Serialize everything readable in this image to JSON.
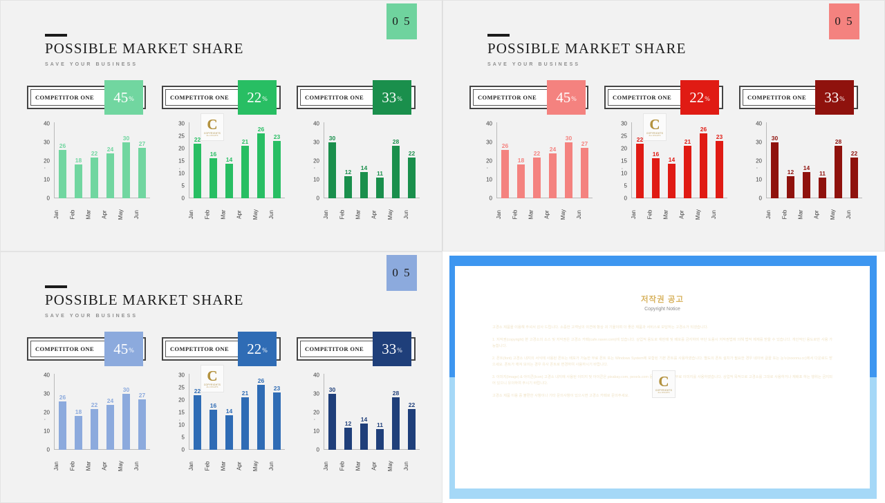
{
  "panels": [
    {
      "id": "green",
      "badge": "0 5",
      "badge_color": "#6fd39e",
      "title": "POSSIBLE MARKET SHARE",
      "subtitle": "SAVE YOUR BUSINESS",
      "accents": [
        "#71d6a0",
        "#28be63",
        "#1a8f4c"
      ]
    },
    {
      "id": "red",
      "badge": "0 5",
      "badge_color": "#f4827f",
      "title": "POSSIBLE MARKET SHARE",
      "subtitle": "SAVE YOUR BUSINESS",
      "accents": [
        "#f4827f",
        "#e01b14",
        "#8f120d"
      ]
    },
    {
      "id": "blue",
      "badge": "0 5",
      "badge_color": "#8caadd",
      "title": "POSSIBLE MARKET SHARE",
      "subtitle": "SAVE YOUR BUSINESS",
      "accents": [
        "#8caadd",
        "#2f6cb5",
        "#1f3f7a"
      ]
    }
  ],
  "meters": [
    {
      "label": "COMPETITOR ONE",
      "value": "45",
      "symbol": "%"
    },
    {
      "label": "COMPETITOR ONE",
      "value": "22",
      "symbol": "%"
    },
    {
      "label": "COMPETITOR ONE",
      "value": "33",
      "symbol": "%"
    }
  ],
  "watermark": {
    "letter": "C",
    "line1": "COPYRIGHTS",
    "line2": "ALL RIGHTS"
  },
  "copyright": {
    "title_kr": "저작권 공고",
    "title_en": "Copyright Notice",
    "paragraphs": [
      "고경소 제품을 이용해 주셔서 감사 드립니다. 소중한 고객님의 의견에 항상 귀 기울이며 더 좋은 제품과 서비스로 보답하는 고경소가 되겠습니다.",
      "1. 저작권(copyright) 본 고경소의 소스 및 저작권은 고경소 카페(cafe.naver.com)에 있습니다. 상업적 용도로 재판매 및 배포를 금지하며 무단 도용시 저작권법에 의해 법적 제재를 받을 수 있습니다. 개인적인 용도로만 사용 가능합니다.",
      "2. 폰트(font) 고경소 내지의 서식에 사용된 폰트는 배포가 가능한 무료 폰트 또는 Windows System에 포함된 기본 폰트를 사용하였습니다. 별도의 폰트 설치가 필요한 경우 네이버 글꼴 또는 눈누(noonnu.cc)에서 다운로드 받으세요. 폰트가 깨져 보이는 경우 유사 폰트로 변경하여 사용하시기 바랍니다.",
      "3. 이미지(Image) & 아이콘(Icon) 고경소 내지에 사용된 이미지 및 아이콘은 pixabay.com, pexels.com 등에서 제공하는 무료 이미지를 사용하였습니다. 상업적 목적으로 고경소를 그대로 사용하거나 재배포 하는 행위는 금지되어 있으니 유의하여 주시기 바랍니다.",
      "고경소 제품 이용 중 불편한 사항이나 기타 문의사항이 있으시면 고경소 카페로 문의주세요."
    ]
  },
  "chart_data": {
    "type": "bar",
    "charts": [
      {
        "name": "competitor-one-chart-1",
        "categories": [
          "Jan",
          "Feb",
          "Mar",
          "Apr",
          "May",
          "Jun"
        ],
        "values": [
          26,
          18,
          22,
          24,
          30,
          27
        ],
        "yticks": [
          "40",
          "30",
          "20",
          "10",
          "0"
        ],
        "ylim": [
          0,
          40
        ],
        "title": "",
        "xlabel": "",
        "ylabel": "",
        "grid": false,
        "legend": "none"
      },
      {
        "name": "competitor-one-chart-2",
        "categories": [
          "Jan",
          "Feb",
          "Mar",
          "Apr",
          "May",
          "Jun"
        ],
        "values": [
          22,
          16,
          14,
          21,
          26,
          23
        ],
        "yticks": [
          "30",
          "25",
          "20",
          "15",
          "10",
          "5",
          "0"
        ],
        "ylim": [
          0,
          30
        ],
        "title": "",
        "xlabel": "",
        "ylabel": "",
        "grid": false,
        "legend": "none"
      },
      {
        "name": "competitor-one-chart-3",
        "categories": [
          "Jan",
          "Feb",
          "Mar",
          "Apr",
          "May",
          "Jun"
        ],
        "values": [
          30,
          12,
          14,
          11,
          28,
          22
        ],
        "yticks": [
          "40",
          "30",
          "20",
          "10",
          "0"
        ],
        "ylim": [
          0,
          40
        ],
        "title": "",
        "xlabel": "",
        "ylabel": "",
        "grid": false,
        "legend": "none"
      }
    ]
  }
}
